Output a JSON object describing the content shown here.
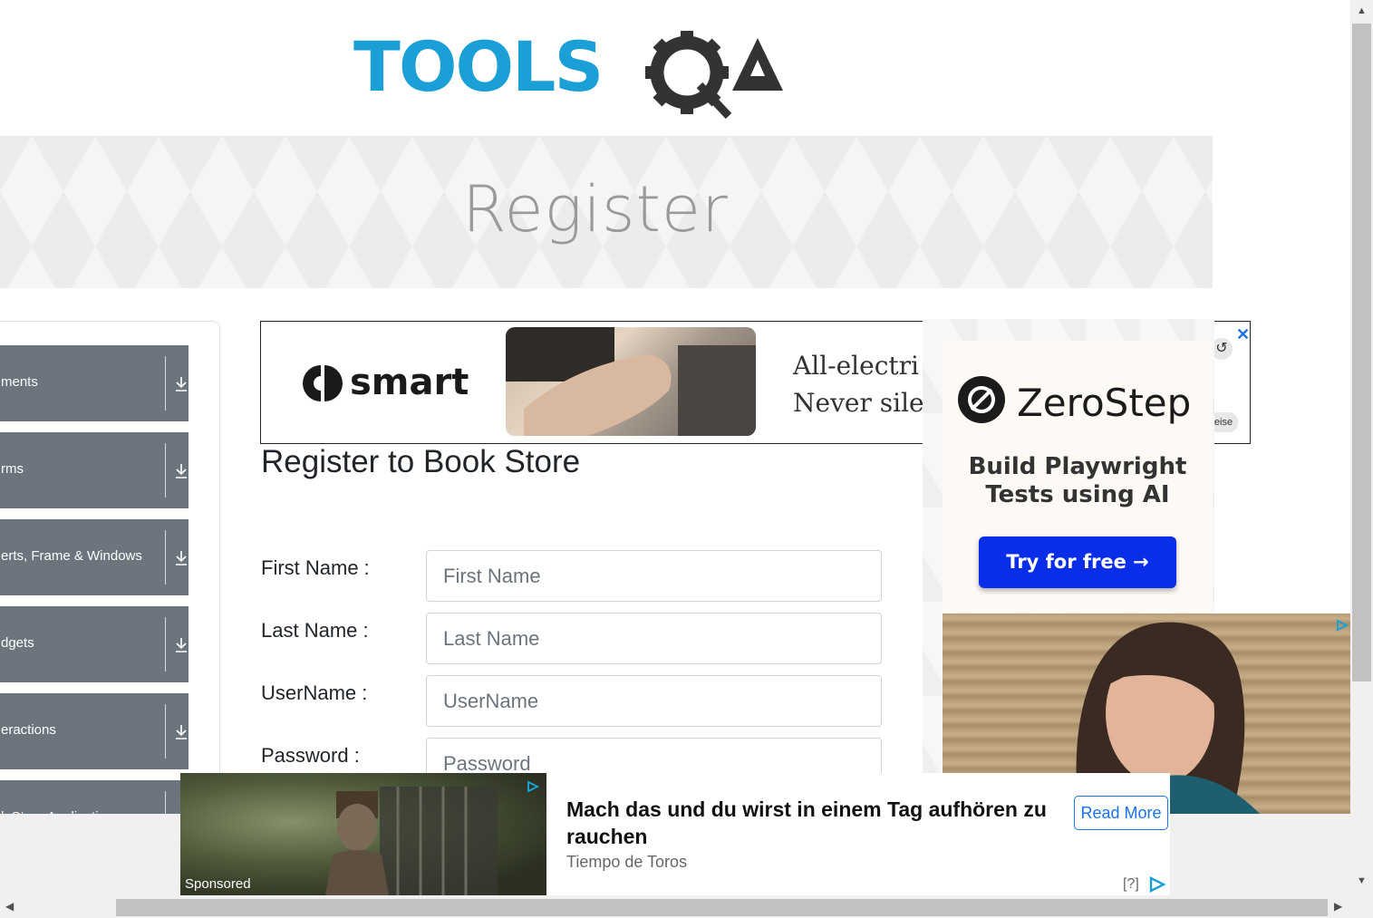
{
  "logo": {
    "text_left": "TOOLS",
    "text_right": "QA",
    "brand_blue": "#1a9fd6",
    "brand_dark": "#333333"
  },
  "banner": {
    "title": "Register"
  },
  "sidebar": {
    "groups": [
      {
        "label": "ments",
        "icon": "download-arrow-icon"
      },
      {
        "label": "rms",
        "icon": "download-arrow-icon"
      },
      {
        "label": "erts, Frame & Windows",
        "icon": "download-arrow-icon"
      },
      {
        "label": "dgets",
        "icon": "download-arrow-icon"
      },
      {
        "label": "eractions",
        "icon": "download-arrow-icon"
      },
      {
        "label": "k Store Application",
        "icon": "download-arrow-icon"
      }
    ],
    "color": "#6c757d"
  },
  "form": {
    "title": "Register to Book Store",
    "first_name_label": "First Name :",
    "first_name_placeholder": "First Name",
    "last_name_label": "Last Name :",
    "last_name_placeholder": "Last Name",
    "username_label": "UserName :",
    "username_placeholder": "UserName",
    "password_label": "Password :",
    "password_placeholder": "Password"
  },
  "ad_top": {
    "brand": "smart",
    "text_line1": "All-electri",
    "text_line2": "Never sile",
    "close": "✕",
    "replay": "↺",
    "hint": "eise"
  },
  "ad_right": {
    "brand": "ZeroStep",
    "subtitle_line1": "Build Playwright",
    "subtitle_line2": "Tests using AI",
    "cta": "Try for free →",
    "cta_color": "#0a2ee8"
  },
  "ad_bottom": {
    "sponsored": "Sponsored",
    "headline": "Mach das und du wirst in einem Tag aufhören zu rauchen",
    "source": "Tiempo de Toros",
    "cta": "Read More",
    "help": "[?]"
  },
  "scrollbars": {
    "up": "▲",
    "down": "▼",
    "left": "◀",
    "right": "▶"
  }
}
